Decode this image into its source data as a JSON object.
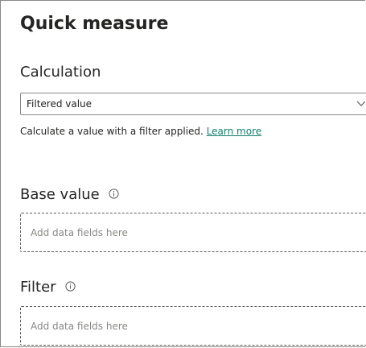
{
  "panel": {
    "title": "Quick measure"
  },
  "calculation": {
    "label": "Calculation",
    "selected": "Filtered value",
    "description": "Calculate a value with a filter applied. ",
    "learn_more": "Learn more"
  },
  "base_value": {
    "label": "Base value",
    "placeholder": "Add data fields here"
  },
  "filter": {
    "label": "Filter",
    "placeholder": "Add data fields here"
  },
  "icons": {
    "info": "info-icon",
    "dropdown": "chevron-down-icon"
  },
  "colors": {
    "link": "#11806a",
    "text": "#252423",
    "placeholder": "#8a8886"
  }
}
